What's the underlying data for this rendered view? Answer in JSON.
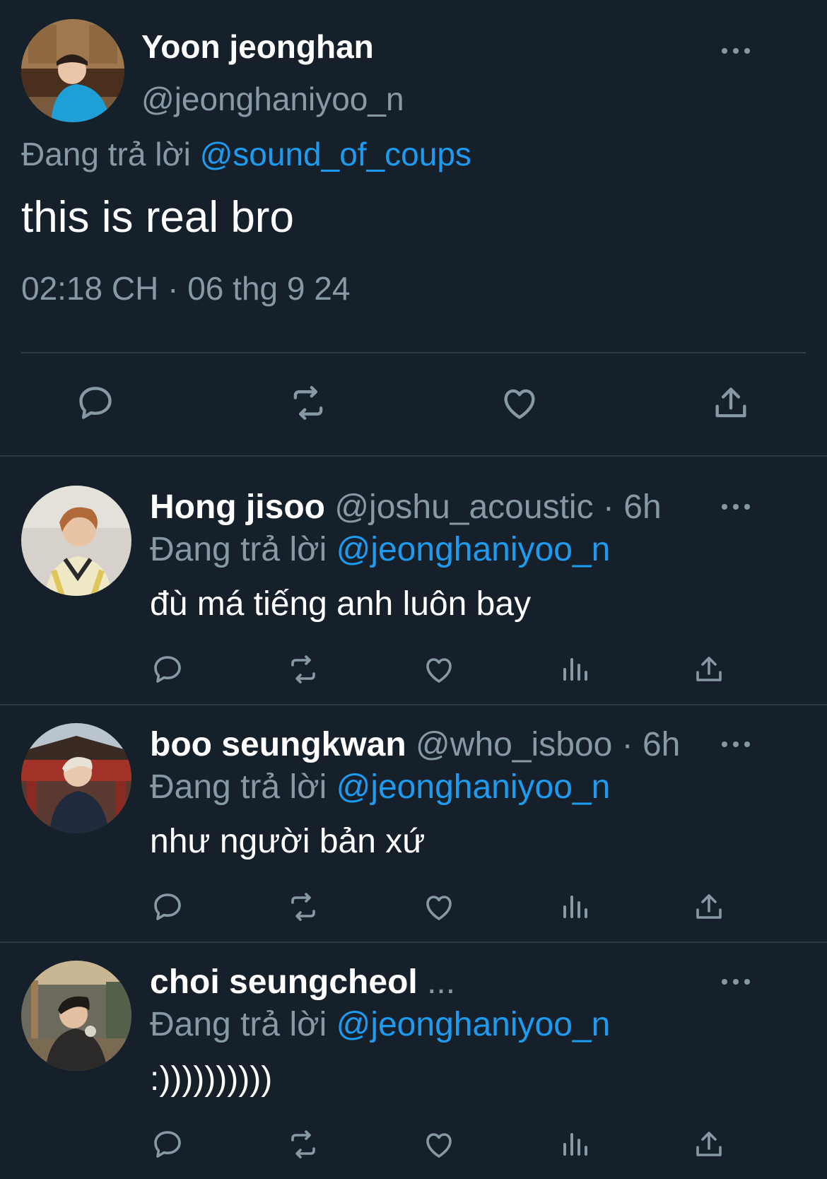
{
  "main_tweet": {
    "name": "Yoon jeonghan",
    "handle": "@jeonghaniyoo_n",
    "reply_prefix": "Đang trả lời",
    "reply_to": "@sound_of_coups",
    "text": "this is real bro",
    "timestamp": "02:18 CH · 06 thg 9 24",
    "actions": [
      "comment-icon",
      "retweet-icon",
      "like-icon",
      "share-icon"
    ]
  },
  "replies": [
    {
      "name": "Hong jisoo",
      "handle": "@joshu_acoustic",
      "time": "· 6h",
      "reply_prefix": "Đang trả lời",
      "reply_to": "@jeonghaniyoo_n",
      "text": "đù má tiếng anh luôn bay"
    },
    {
      "name": "boo seungkwan",
      "handle": "@who_isboo",
      "time": "· 6h",
      "reply_prefix": "Đang trả lời",
      "reply_to": "@jeonghaniyoo_n",
      "text": "như người bản xứ"
    },
    {
      "name": "choi seungcheol",
      "truncation": "...",
      "reply_prefix": "Đang trả lời",
      "reply_to": "@jeonghaniyoo_n",
      "text": ":))))))))))"
    }
  ],
  "colors": {
    "background": "#15202b",
    "muted": "#8899a6",
    "link": "#1d9bf0",
    "divider": "#2f3d4a"
  }
}
